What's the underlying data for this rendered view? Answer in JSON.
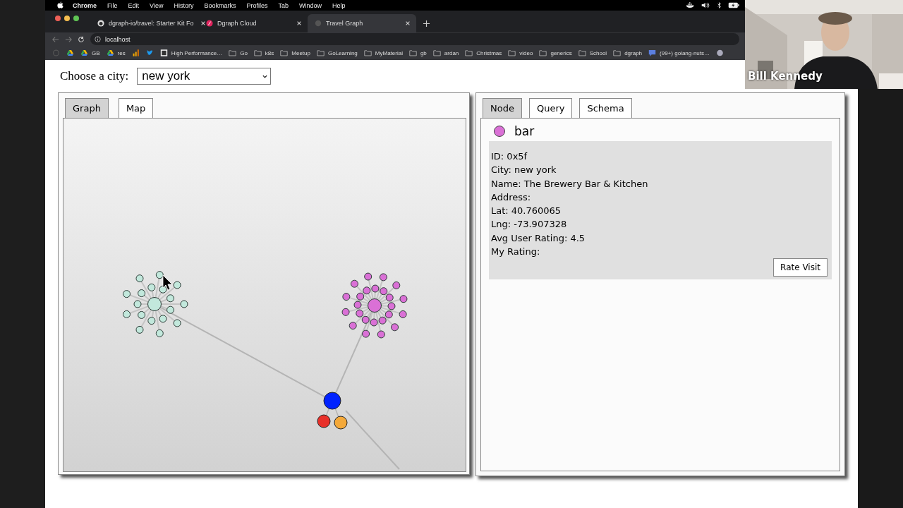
{
  "menubar": {
    "app": "Chrome",
    "items": [
      "File",
      "Edit",
      "View",
      "History",
      "Bookmarks",
      "Profiles",
      "Tab",
      "Window",
      "Help"
    ]
  },
  "browser": {
    "tabs": [
      {
        "title": "dgraph-io/travel: Starter Kit Fo",
        "kind": "github",
        "selected": false
      },
      {
        "title": "Dgraph Cloud",
        "kind": "dgraph",
        "selected": false
      },
      {
        "title": "Travel Graph",
        "kind": "page",
        "selected": true
      }
    ],
    "address": "localhost",
    "bookmarks": [
      {
        "kind": "circle"
      },
      {
        "kind": "drive"
      },
      {
        "kind": "drive",
        "label": "GB"
      },
      {
        "kind": "drive",
        "label": "res"
      },
      {
        "kind": "chart"
      },
      {
        "kind": "bird"
      },
      {
        "kind": "site",
        "label": "High Performance…"
      },
      {
        "kind": "folder",
        "label": "Go"
      },
      {
        "kind": "folder",
        "label": "k8s"
      },
      {
        "kind": "folder",
        "label": "Meetup"
      },
      {
        "kind": "folder",
        "label": "GoLearning"
      },
      {
        "kind": "folder",
        "label": "MyMaterial"
      },
      {
        "kind": "folder",
        "label": "gb"
      },
      {
        "kind": "folder",
        "label": "ardan"
      },
      {
        "kind": "folder",
        "label": "Christmas"
      },
      {
        "kind": "folder",
        "label": "video"
      },
      {
        "kind": "folder",
        "label": "generics"
      },
      {
        "kind": "folder",
        "label": "School"
      },
      {
        "kind": "folder",
        "label": "dgraph"
      },
      {
        "kind": "chat",
        "label": "(99+) golang-nuts…"
      },
      {
        "kind": "globe"
      }
    ]
  },
  "page": {
    "city_label": "Choose a city:",
    "city": "new york",
    "left_tabs": [
      {
        "label": "Graph",
        "selected": true
      },
      {
        "label": "Map",
        "selected": false
      }
    ],
    "graph": {
      "nodes": [
        {
          "kind": "cluster",
          "color": "#c2e8dc"
        },
        {
          "kind": "cluster",
          "color": "#da70d6"
        },
        {
          "kind": "hub",
          "color": "#0022ff"
        },
        {
          "kind": "leaf",
          "color": "#e8302a"
        },
        {
          "kind": "leaf",
          "color": "#f4a93a"
        }
      ]
    },
    "right_tabs": [
      {
        "label": "Node",
        "selected": true
      },
      {
        "label": "Query",
        "selected": false
      },
      {
        "label": "Schema",
        "selected": false
      }
    ],
    "node": {
      "type": "bar",
      "color": "#da70d6",
      "fields": [
        "ID: 0x5f",
        "City: new york",
        "Name: The Brewery Bar & Kitchen",
        "Address:",
        "Lat: 40.760065",
        "Lng: -73.907328",
        "Avg User Rating: 4.5",
        "My Rating:"
      ],
      "button": "Rate Visit"
    }
  },
  "video": {
    "participant": "Bill Kennedy"
  }
}
